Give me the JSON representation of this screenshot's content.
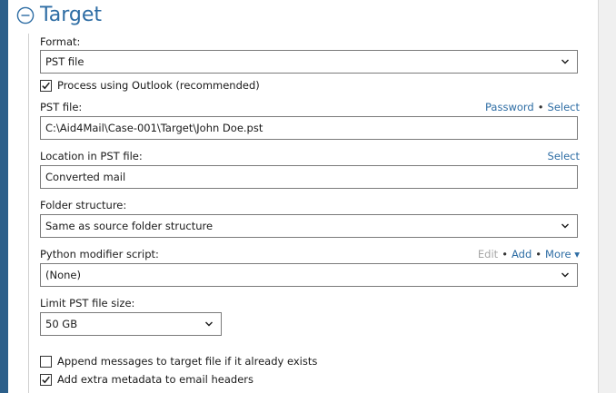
{
  "section": {
    "title": "Target"
  },
  "format": {
    "label": "Format:",
    "value": "PST file"
  },
  "process_outlook": {
    "label": "Process using Outlook (recommended)",
    "checked": true
  },
  "pst_file": {
    "label": "PST file:",
    "password_link": "Password",
    "select_link": "Select",
    "separator": "•",
    "value": "C:\\Aid4Mail\\Case-001\\Target\\John Doe.pst"
  },
  "location": {
    "label": "Location in PST file:",
    "select_link": "Select",
    "value": "Converted mail"
  },
  "folder_structure": {
    "label": "Folder structure:",
    "value": "Same as source folder structure"
  },
  "python_script": {
    "label": "Python modifier script:",
    "edit_link": "Edit",
    "add_link": "Add",
    "more_link": "More",
    "more_arrow": "▾",
    "separator": "•",
    "value": "(None)"
  },
  "limit_size": {
    "label": "Limit PST file size:",
    "value": "50 GB"
  },
  "append_messages": {
    "label": "Append messages to target file if it already exists",
    "checked": false
  },
  "extra_metadata": {
    "label": "Add extra metadata to email headers",
    "checked": true
  },
  "colors": {
    "accent": "#2e6da4",
    "strip": "#2c5f8a",
    "disabled_link": "#a6a6a6",
    "field_border": "#7a7a7a"
  }
}
